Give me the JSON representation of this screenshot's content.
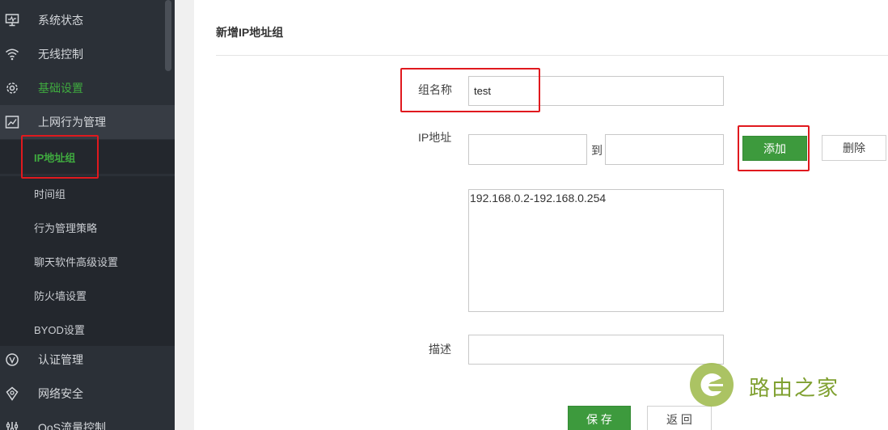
{
  "sidebar": {
    "items": [
      {
        "label": "系统状态",
        "icon": "monitor-icon"
      },
      {
        "label": "无线控制",
        "icon": "wifi-icon"
      },
      {
        "label": "基础设置",
        "icon": "gear-icon"
      },
      {
        "label": "上网行为管理",
        "icon": "trend-chart-icon"
      }
    ],
    "sub_items": [
      {
        "label": "IP地址组"
      },
      {
        "label": "时间组"
      },
      {
        "label": "行为管理策略"
      },
      {
        "label": "聊天软件高级设置"
      },
      {
        "label": "防火墙设置"
      },
      {
        "label": "BYOD设置"
      }
    ],
    "lower_items": [
      {
        "label": "认证管理",
        "icon": "v-circle-icon"
      },
      {
        "label": "网络安全",
        "icon": "shield-icon"
      },
      {
        "label": "QoS流量控制",
        "icon": "qos-icon"
      }
    ],
    "colors": {
      "bg": "#2b3037",
      "active": "#3faa3f"
    }
  },
  "form": {
    "title": "新增IP地址组",
    "group_name_label": "组名称",
    "group_name_value": "test",
    "ip_label": "IP地址",
    "ip_to": "到",
    "ip_start_value": "",
    "ip_end_value": "",
    "add_label": "添加",
    "delete_label": "删除",
    "ip_list": "192.168.0.2-192.168.0.254",
    "desc_label": "描述",
    "desc_value": "",
    "save_label": "保 存",
    "back_label": "返 回"
  },
  "watermark": {
    "text": "路由之家"
  }
}
